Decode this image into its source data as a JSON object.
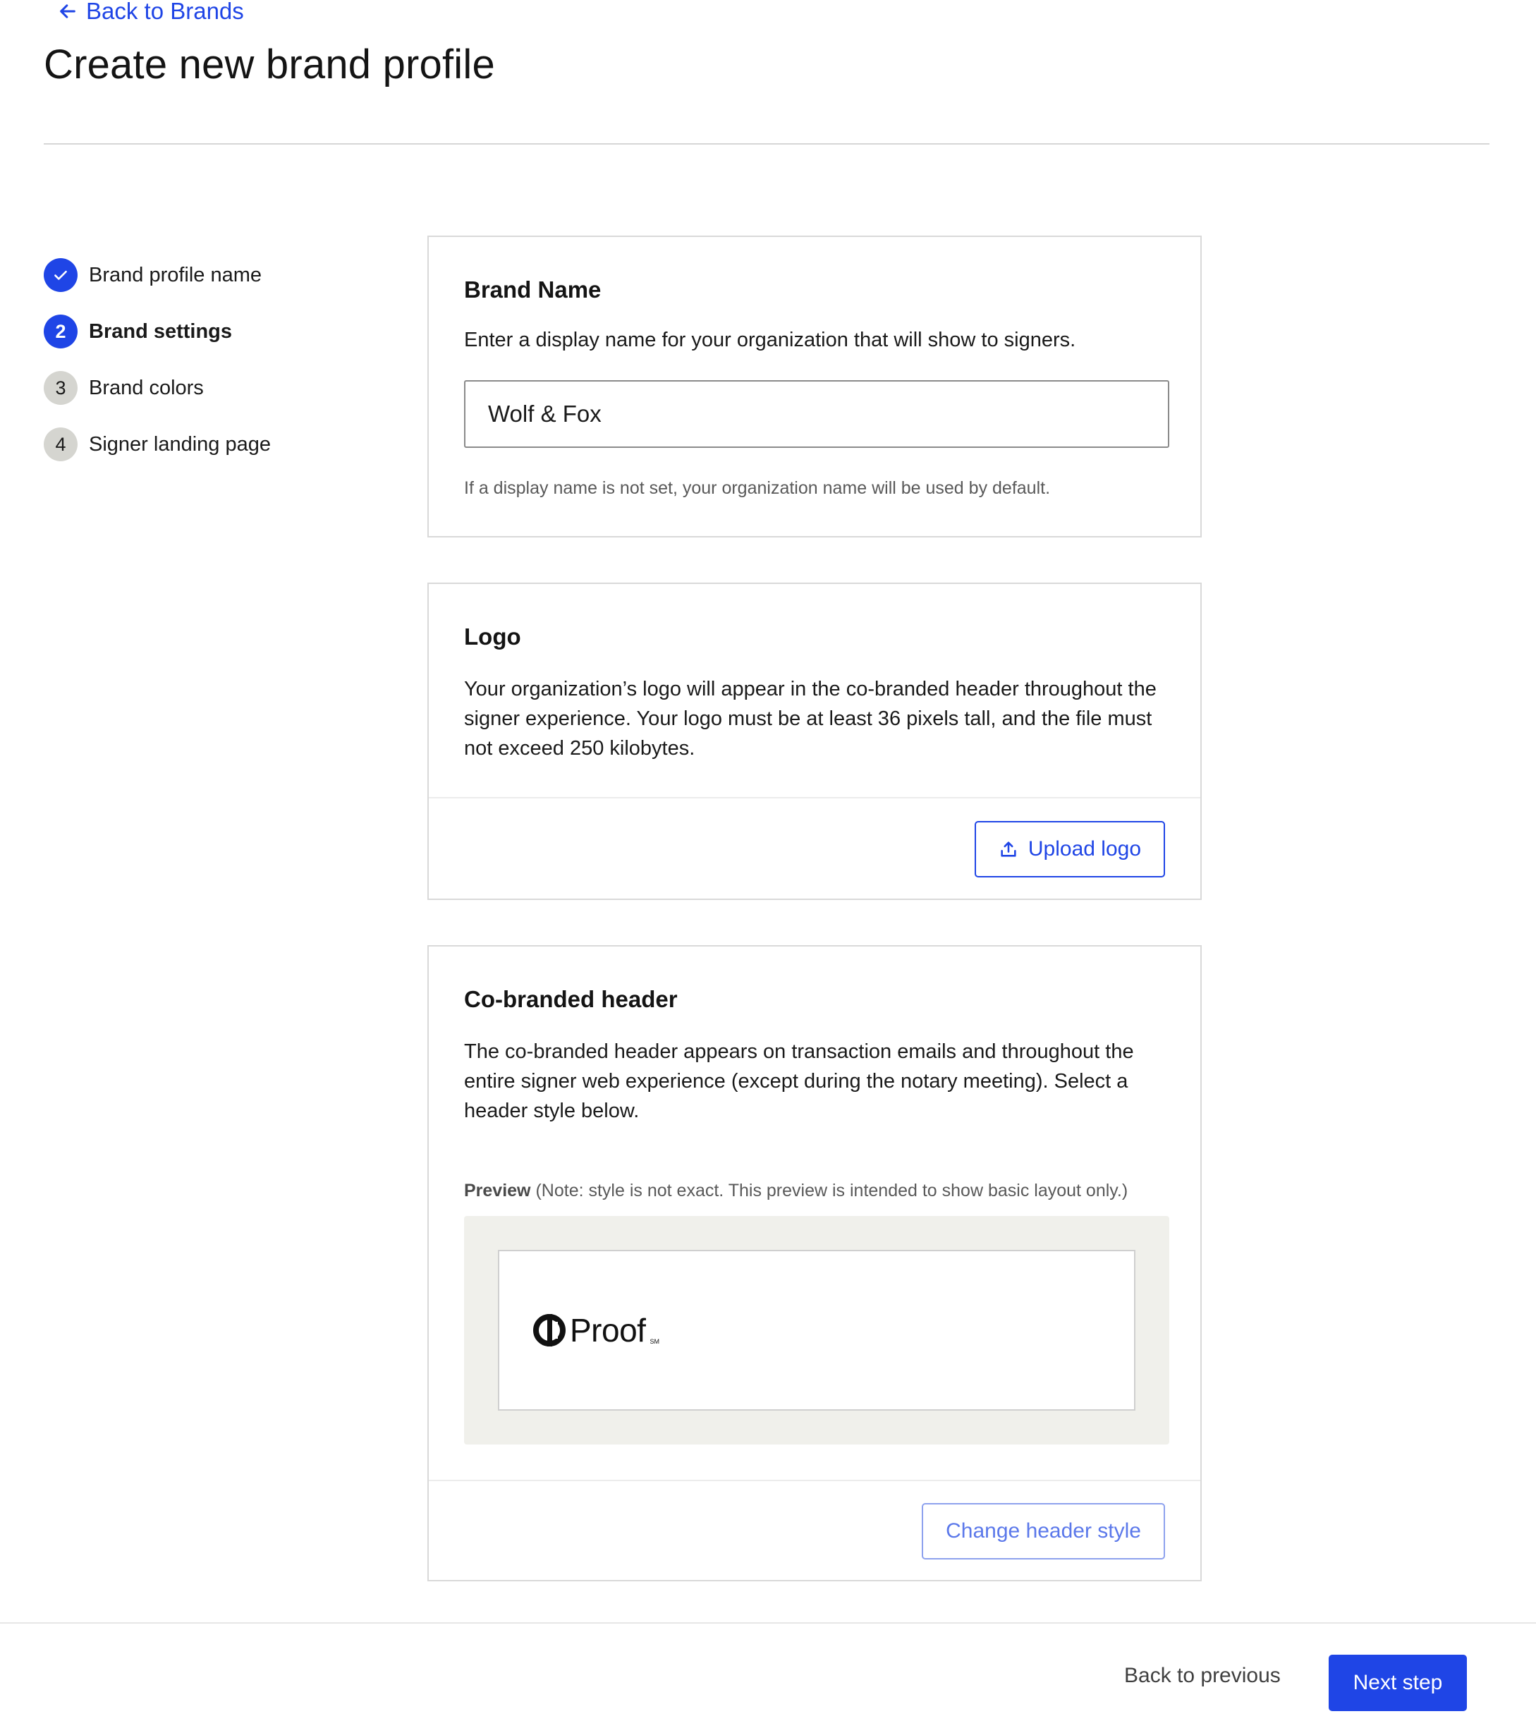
{
  "nav": {
    "back_label": "Back to Brands"
  },
  "page": {
    "title": "Create new brand profile"
  },
  "stepper": {
    "steps": [
      {
        "number": "",
        "label": "Brand profile name",
        "state": "complete"
      },
      {
        "number": "2",
        "label": "Brand settings",
        "state": "active"
      },
      {
        "number": "3",
        "label": "Brand colors",
        "state": "pending"
      },
      {
        "number": "4",
        "label": "Signer landing page",
        "state": "pending"
      }
    ]
  },
  "brand_name": {
    "title": "Brand Name",
    "description": "Enter a display name for your organization that will show to signers.",
    "input_value": "Wolf & Fox",
    "hint": "If a display name is not set, your organization name will be used by default."
  },
  "logo": {
    "title": "Logo",
    "description": "Your organization’s logo will appear in the co-branded header throughout the signer experience. Your logo must be at least 36 pixels tall, and the file must not exceed 250 kilobytes.",
    "upload_label": "Upload logo"
  },
  "header": {
    "title": "Co-branded header",
    "description": "The co-branded header appears on transaction emails and throughout the entire signer web experience (except during the notary meeting). Select a header style below.",
    "preview_label": "Preview",
    "preview_note": " (Note: style is not exact. This preview is intended to show basic layout only.)",
    "preview_logo_text": "Proof",
    "preview_logo_tm": "SM",
    "change_label": "Change header style"
  },
  "footer": {
    "back_label": "Back to previous",
    "next_label": "Next step"
  },
  "colors": {
    "accent": "#1f45e6",
    "pending_badge": "#d5d5d0",
    "preview_bg": "#f0f0eb"
  },
  "icons": [
    "arrow-left-icon",
    "check-icon",
    "upload-icon",
    "proof-logo-icon"
  ]
}
